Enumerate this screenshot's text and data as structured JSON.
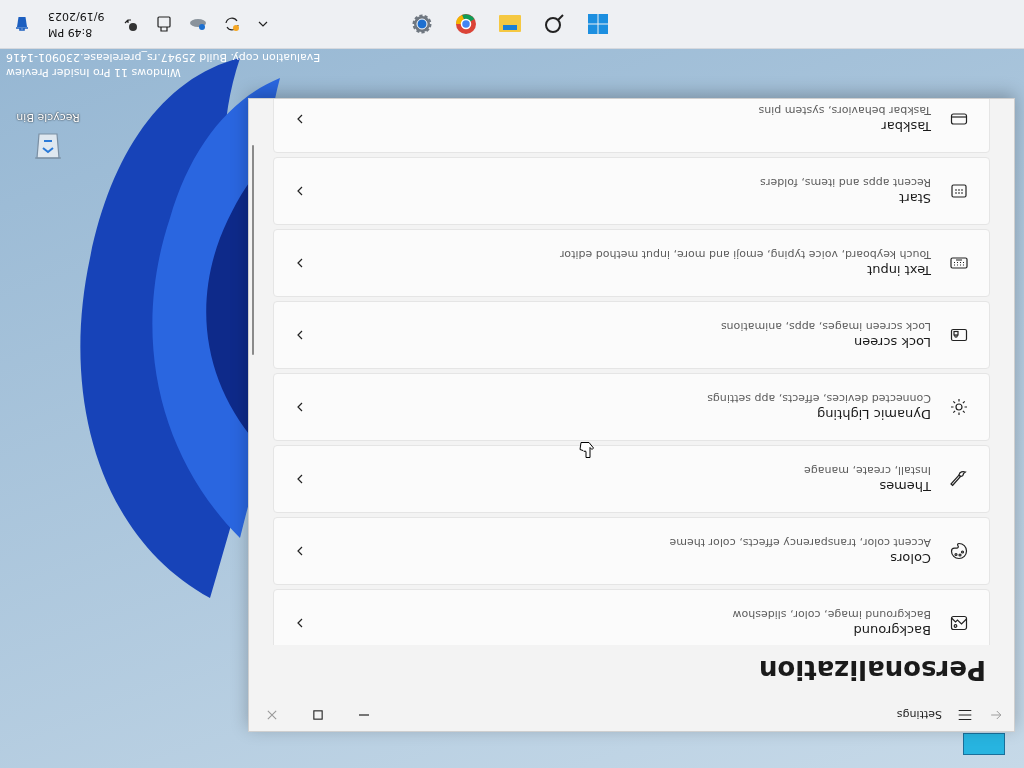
{
  "window": {
    "title": "Settings"
  },
  "page": {
    "title": "Personalization"
  },
  "items": [
    {
      "title": "Background",
      "subtitle": "Background image, color, slideshow"
    },
    {
      "title": "Colors",
      "subtitle": "Accent color, transparency effects, color theme"
    },
    {
      "title": "Themes",
      "subtitle": "Install, create, manage"
    },
    {
      "title": "Dynamic Lighting",
      "subtitle": "Connected devices, effects, app settings"
    },
    {
      "title": "Lock screen",
      "subtitle": "Lock screen images, apps, animations"
    },
    {
      "title": "Text input",
      "subtitle": "Touch keyboard, voice typing, emoji and more, input method editor"
    },
    {
      "title": "Start",
      "subtitle": "Recent apps and items, folders"
    },
    {
      "title": "Taskbar",
      "subtitle": "Taskbar behaviors, system pins"
    }
  ],
  "desktop": {
    "icon_label": "Recycle Bin",
    "watermark": [
      "Windows 11 Pro Insider Preview",
      "Evaluation copy. Build 25947.rs_prerelease.230901-1416"
    ]
  },
  "taskbar": {
    "time": "8:49 PM",
    "date": "9/19/2023"
  }
}
